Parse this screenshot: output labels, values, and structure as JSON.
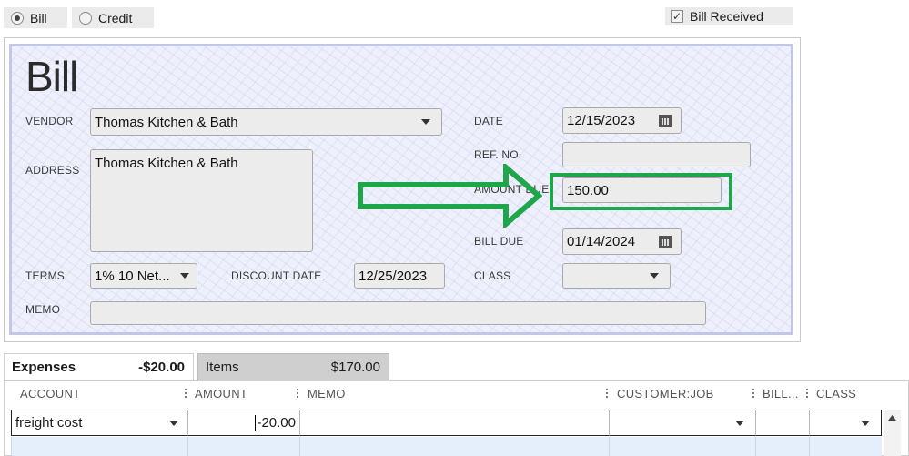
{
  "transaction_type": {
    "bill_label": "Bill",
    "credit_label": "Credit",
    "selected": "Bill"
  },
  "bill_received": {
    "label": "Bill Received",
    "checked": true
  },
  "form": {
    "title": "Bill",
    "vendor_label": "VENDOR",
    "vendor_value": "Thomas Kitchen & Bath",
    "address_label": "ADDRESS",
    "address_value": "Thomas Kitchen & Bath",
    "date_label": "DATE",
    "date_value": "12/15/2023",
    "ref_no_label": "REF. NO.",
    "ref_no_value": "",
    "amount_due_label": "AMOUNT DUE",
    "amount_due_value": "150.00",
    "bill_due_label": "BILL DUE",
    "bill_due_value": "01/14/2024",
    "terms_label": "TERMS",
    "terms_value": "1% 10 Net...",
    "discount_date_label": "DISCOUNT DATE",
    "discount_date_value": "12/25/2023",
    "class_label": "CLASS",
    "class_value": "",
    "memo_label": "MEMO",
    "memo_value": ""
  },
  "annotation": {
    "color": "#1fa54a"
  },
  "tabs": [
    {
      "label": "Expenses",
      "amount": "-$20.00",
      "active": true
    },
    {
      "label": "Items",
      "amount": "$170.00",
      "active": false
    }
  ],
  "expense_table": {
    "columns": [
      "ACCOUNT",
      "AMOUNT",
      "MEMO",
      "CUSTOMER:JOB",
      "BILL...",
      "CLASS"
    ],
    "rows": [
      {
        "account": "freight cost",
        "amount": "-20.00",
        "memo": "",
        "customer_job": "",
        "billable": "",
        "class": ""
      }
    ]
  }
}
